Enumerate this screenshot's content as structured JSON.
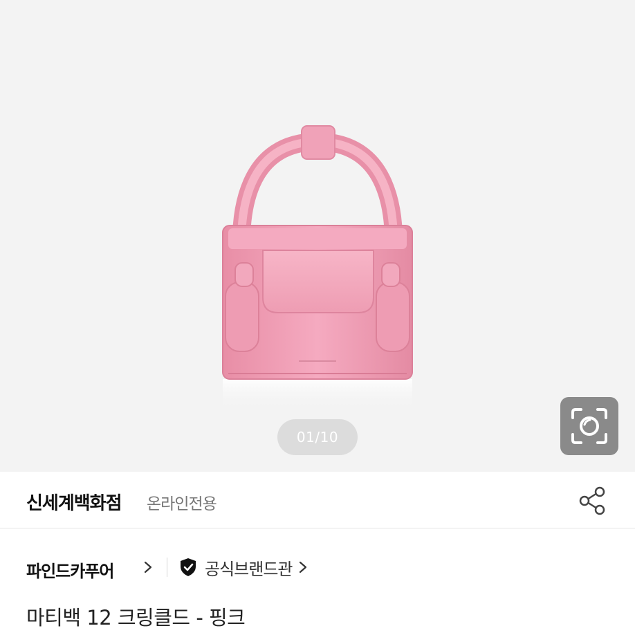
{
  "gallery": {
    "image_alt": "pink mini handbag",
    "counter": "01/10",
    "lens_icon": "camera-lens-search-icon"
  },
  "store": {
    "name": "신세계백화점",
    "tag": "온라인전용",
    "share_icon": "share-icon"
  },
  "brand": {
    "name": "파인드카푸어",
    "official_label": "공식브랜드관",
    "official_icon": "shield-check-icon"
  },
  "product": {
    "title": "마티백 12 크링클드 - 핑크"
  },
  "colors": {
    "bag_pink": "#f2a3b8",
    "bag_shadow": "#e38aa2",
    "hero_bg": "#f3f3f3",
    "counter_bg": "#dcdcdc",
    "lens_bg": "#8a8a8a"
  }
}
